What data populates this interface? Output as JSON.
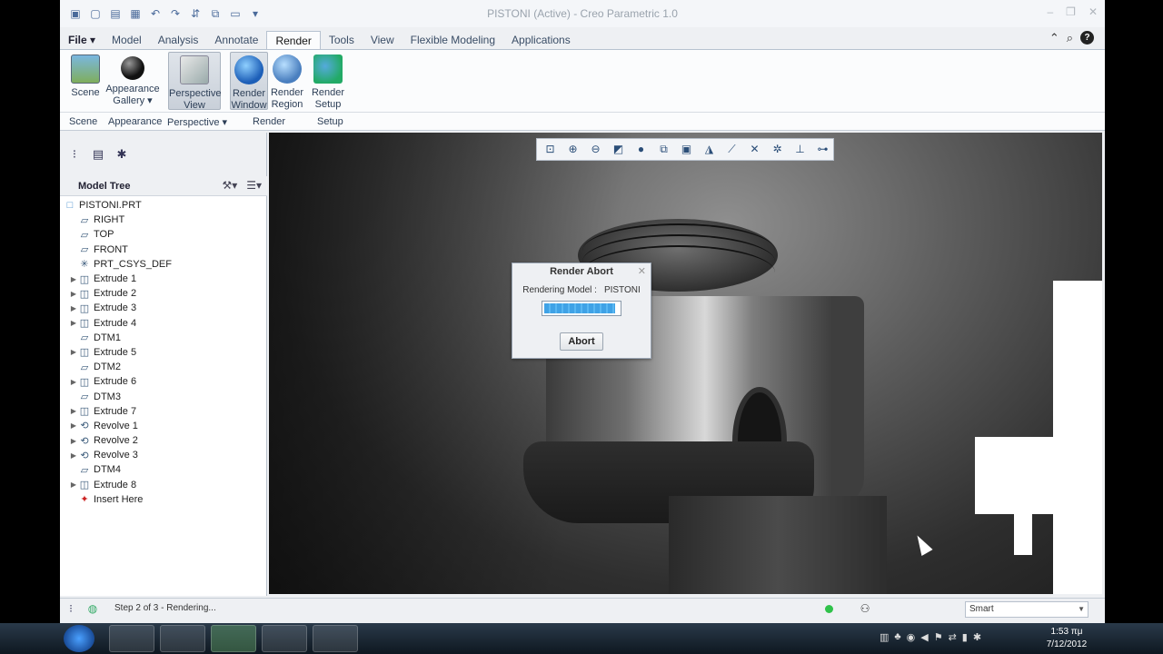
{
  "window": {
    "title": "PISTONI (Active) - Creo Parametric 1.0"
  },
  "ribbon": {
    "tabs": [
      {
        "label": "File ▾"
      },
      {
        "label": "Model"
      },
      {
        "label": "Analysis"
      },
      {
        "label": "Annotate"
      },
      {
        "label": "Render"
      },
      {
        "label": "Tools"
      },
      {
        "label": "View"
      },
      {
        "label": "Flexible Modeling"
      },
      {
        "label": "Applications"
      }
    ],
    "active_tab": "Render",
    "buttons": {
      "scene": "Scene",
      "appearance_gallery": "Appearance Gallery ▾",
      "perspective_view": "Perspective View",
      "render_window": "Render Window",
      "render_region": "Render Region",
      "render_setup": "Render Setup"
    },
    "groups": {
      "scene": "Scene",
      "appearance": "Appearance",
      "perspective": "Perspective ▾",
      "render": "Render",
      "setup": "Setup"
    }
  },
  "model_tree": {
    "title": "Model Tree",
    "items": [
      {
        "label": "PISTONI.PRT",
        "icon": "□",
        "expandable": false
      },
      {
        "label": "RIGHT",
        "icon": "▱",
        "expandable": false
      },
      {
        "label": "TOP",
        "icon": "▱",
        "expandable": false
      },
      {
        "label": "FRONT",
        "icon": "▱",
        "expandable": false
      },
      {
        "label": "PRT_CSYS_DEF",
        "icon": "✳",
        "expandable": false
      },
      {
        "label": "Extrude 1",
        "icon": "◫",
        "expandable": true
      },
      {
        "label": "Extrude 2",
        "icon": "◫",
        "expandable": true
      },
      {
        "label": "Extrude 3",
        "icon": "◫",
        "expandable": true
      },
      {
        "label": "Extrude 4",
        "icon": "◫",
        "expandable": true
      },
      {
        "label": "DTM1",
        "icon": "▱",
        "expandable": false
      },
      {
        "label": "Extrude 5",
        "icon": "◫",
        "expandable": true
      },
      {
        "label": "DTM2",
        "icon": "▱",
        "expandable": false
      },
      {
        "label": "Extrude 6",
        "icon": "◫",
        "expandable": true
      },
      {
        "label": "DTM3",
        "icon": "▱",
        "expandable": false
      },
      {
        "label": "Extrude 7",
        "icon": "◫",
        "expandable": true
      },
      {
        "label": "Revolve 1",
        "icon": "⟲",
        "expandable": true
      },
      {
        "label": "Revolve 2",
        "icon": "⟲",
        "expandable": true
      },
      {
        "label": "Revolve 3",
        "icon": "⟲",
        "expandable": true
      },
      {
        "label": "DTM4",
        "icon": "▱",
        "expandable": false
      },
      {
        "label": "Extrude 8",
        "icon": "◫",
        "expandable": true
      },
      {
        "label": "Insert Here",
        "icon": "✦",
        "expandable": false
      }
    ]
  },
  "dialog": {
    "title": "Render Abort",
    "label": "Rendering Model :",
    "model": "PISTONI",
    "progress": 0.95,
    "abort_label": "Abort"
  },
  "status": {
    "message": "Step 2 of 3 - Rendering...",
    "filter_value": "Smart"
  },
  "taskbar": {
    "time": "1:53 πμ",
    "date": "7/12/2012"
  },
  "colors": {
    "accent": "#3fa2e6",
    "status_green": "#2fc24a"
  }
}
